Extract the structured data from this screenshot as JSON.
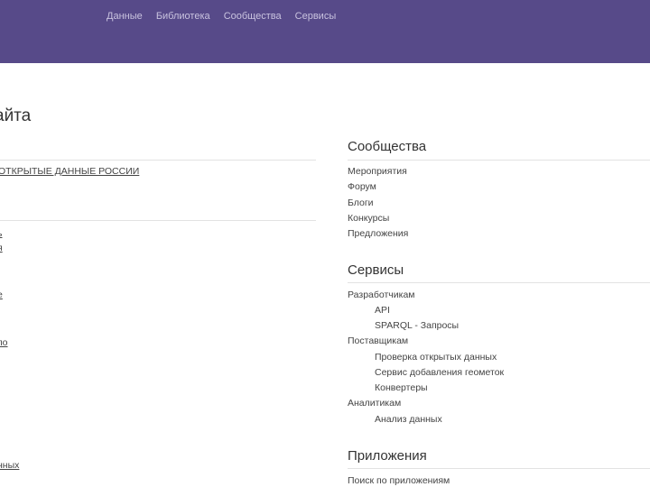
{
  "nav": {
    "items": [
      "Данные",
      "Библиотека",
      "Сообщества",
      "Сервисы"
    ]
  },
  "page_title": "айта",
  "left": {
    "lines": [
      "ОТКРЫТЫЕ ДАННЫЕ РОССИИ",
      "ь",
      "я",
      "е",
      "по",
      "нных"
    ]
  },
  "communities": {
    "title": "Сообщества",
    "items": [
      "Мероприятия",
      "Форум",
      "Блоги",
      "Конкурсы",
      "Предложения"
    ]
  },
  "services": {
    "title": "Сервисы",
    "items": [
      {
        "label": "Разработчикам",
        "indent": false
      },
      {
        "label": "API",
        "indent": true
      },
      {
        "label": "SPARQL - Запросы",
        "indent": true
      },
      {
        "label": "Поставщикам",
        "indent": false
      },
      {
        "label": "Проверка открытых данных",
        "indent": true
      },
      {
        "label": "Сервис добавления геометок",
        "indent": true
      },
      {
        "label": "Конвертеры",
        "indent": true
      },
      {
        "label": "Аналитикам",
        "indent": false
      },
      {
        "label": "Анализ данных",
        "indent": true
      }
    ]
  },
  "apps": {
    "title": "Приложения",
    "items": [
      "Поиск по приложениям"
    ]
  },
  "colors": {
    "topbar": "#574a89",
    "nav_text": "#c9c3df"
  }
}
